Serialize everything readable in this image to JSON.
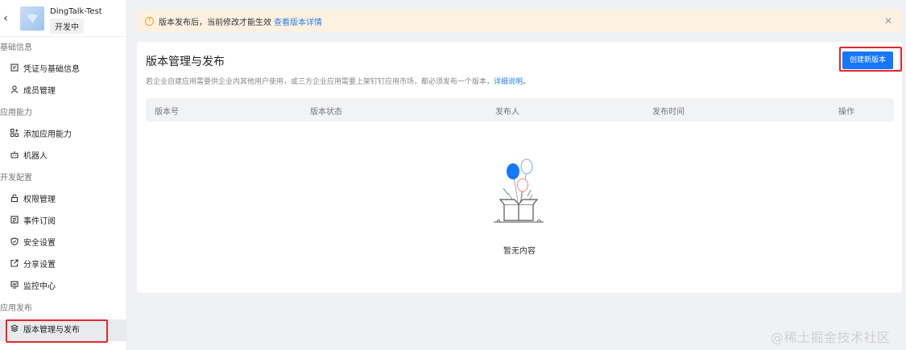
{
  "app": {
    "name": "DingTalk-Test",
    "status": "开发中"
  },
  "sidebar": {
    "groups": [
      {
        "title": "基础信息",
        "items": [
          {
            "label": "凭证与基础信息",
            "icon": "credential-icon"
          },
          {
            "label": "成员管理",
            "icon": "user-icon"
          }
        ]
      },
      {
        "title": "应用能力",
        "items": [
          {
            "label": "添加应用能力",
            "icon": "add-capability-icon"
          },
          {
            "label": "机器人",
            "icon": "robot-icon"
          }
        ]
      },
      {
        "title": "开发配置",
        "items": [
          {
            "label": "权限管理",
            "icon": "lock-icon"
          },
          {
            "label": "事件订阅",
            "icon": "event-icon"
          },
          {
            "label": "安全设置",
            "icon": "shield-icon"
          },
          {
            "label": "分享设置",
            "icon": "share-icon"
          },
          {
            "label": "监控中心",
            "icon": "monitor-icon"
          }
        ]
      },
      {
        "title": "应用发布",
        "items": [
          {
            "label": "版本管理与发布",
            "icon": "layers-icon",
            "active": true
          }
        ]
      }
    ]
  },
  "notice": {
    "text": "版本发布后，当前修改才能生效",
    "link": "查看版本详情"
  },
  "main": {
    "title": "版本管理与发布",
    "description": "若企业自建应用需要供企业内其他用户使用，或三方企业应用需要上架钉钉应用市场，都必须发布一个版本，",
    "description_link": "详细说明。",
    "create_button": "创建新版本",
    "columns": [
      "版本号",
      "版本状态",
      "发布人",
      "发布时间",
      "操作"
    ],
    "empty_text": "暂无内容"
  },
  "watermark": "@稀土掘金技术社区",
  "colors": {
    "primary": "#1677ff",
    "highlight": "#e5262c",
    "notice_bg": "#fdf1e2"
  }
}
